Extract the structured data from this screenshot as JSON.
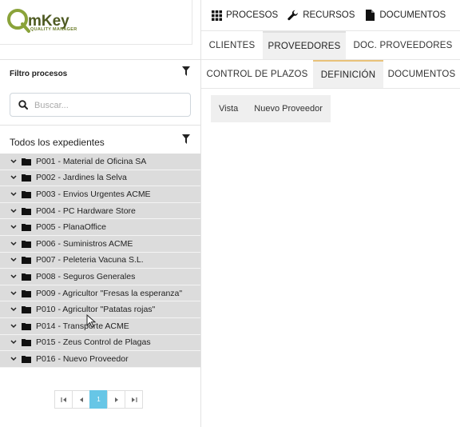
{
  "brand": {
    "logo_text": "QmKey",
    "tagline": "QUALITY MANAGER",
    "colors": {
      "green": "#8aa33a",
      "dark": "#4e5a22"
    }
  },
  "left": {
    "filter_title": "Filtro procesos",
    "search_placeholder": "Buscar...",
    "all_title": "Todos los expedientes",
    "items": [
      {
        "label": "P001 - Material de Oficina SA"
      },
      {
        "label": "P002 - Jardines la Selva"
      },
      {
        "label": "P003 - Envios Urgentes ACME"
      },
      {
        "label": "P004 - PC Hardware Store"
      },
      {
        "label": "P005 - PlanaOffice"
      },
      {
        "label": "P006 - Suministros ACME"
      },
      {
        "label": "P007 - Peleteria Vacuna S.L."
      },
      {
        "label": "P008 - Seguros Generales"
      },
      {
        "label": "P009 - Agricultor \"Fresas la esperanza\""
      },
      {
        "label": "P010 - Agricultor \"Patatas rojas\""
      },
      {
        "label": "P014 - Transporte ACME"
      },
      {
        "label": "P015 - Zeus Control de Plagas"
      },
      {
        "label": "P016 - Nuevo Proveedor"
      }
    ],
    "pager": {
      "first": "|◀",
      "prev": "◀",
      "current": "1",
      "next": "▶",
      "last": "▶|"
    }
  },
  "topnav": {
    "items": [
      {
        "label": "PROCESOS",
        "icon": "grid-icon"
      },
      {
        "label": "RECURSOS",
        "icon": "wrench-icon"
      },
      {
        "label": "DOCUMENTOS",
        "icon": "document-icon"
      }
    ]
  },
  "tabs_row1": [
    {
      "label": "CLIENTES",
      "active": false
    },
    {
      "label": "PROVEEDORES",
      "active": true
    },
    {
      "label": "DOC. PROVEEDORES",
      "active": false
    }
  ],
  "tabs_row2": [
    {
      "label": "CONTROL DE PLAZOS",
      "active": false
    },
    {
      "label": "DEFINICIÓN",
      "active": true
    },
    {
      "label": "DOCUMENTOS",
      "active": false
    }
  ],
  "subtabs": [
    {
      "label": "Vista"
    },
    {
      "label": "Nuevo Proveedor"
    }
  ],
  "colors": {
    "tree_row_bg": "#dcdcdc",
    "active_tab_accent": "#e9c27a",
    "pager_active": "#67c6e6"
  }
}
